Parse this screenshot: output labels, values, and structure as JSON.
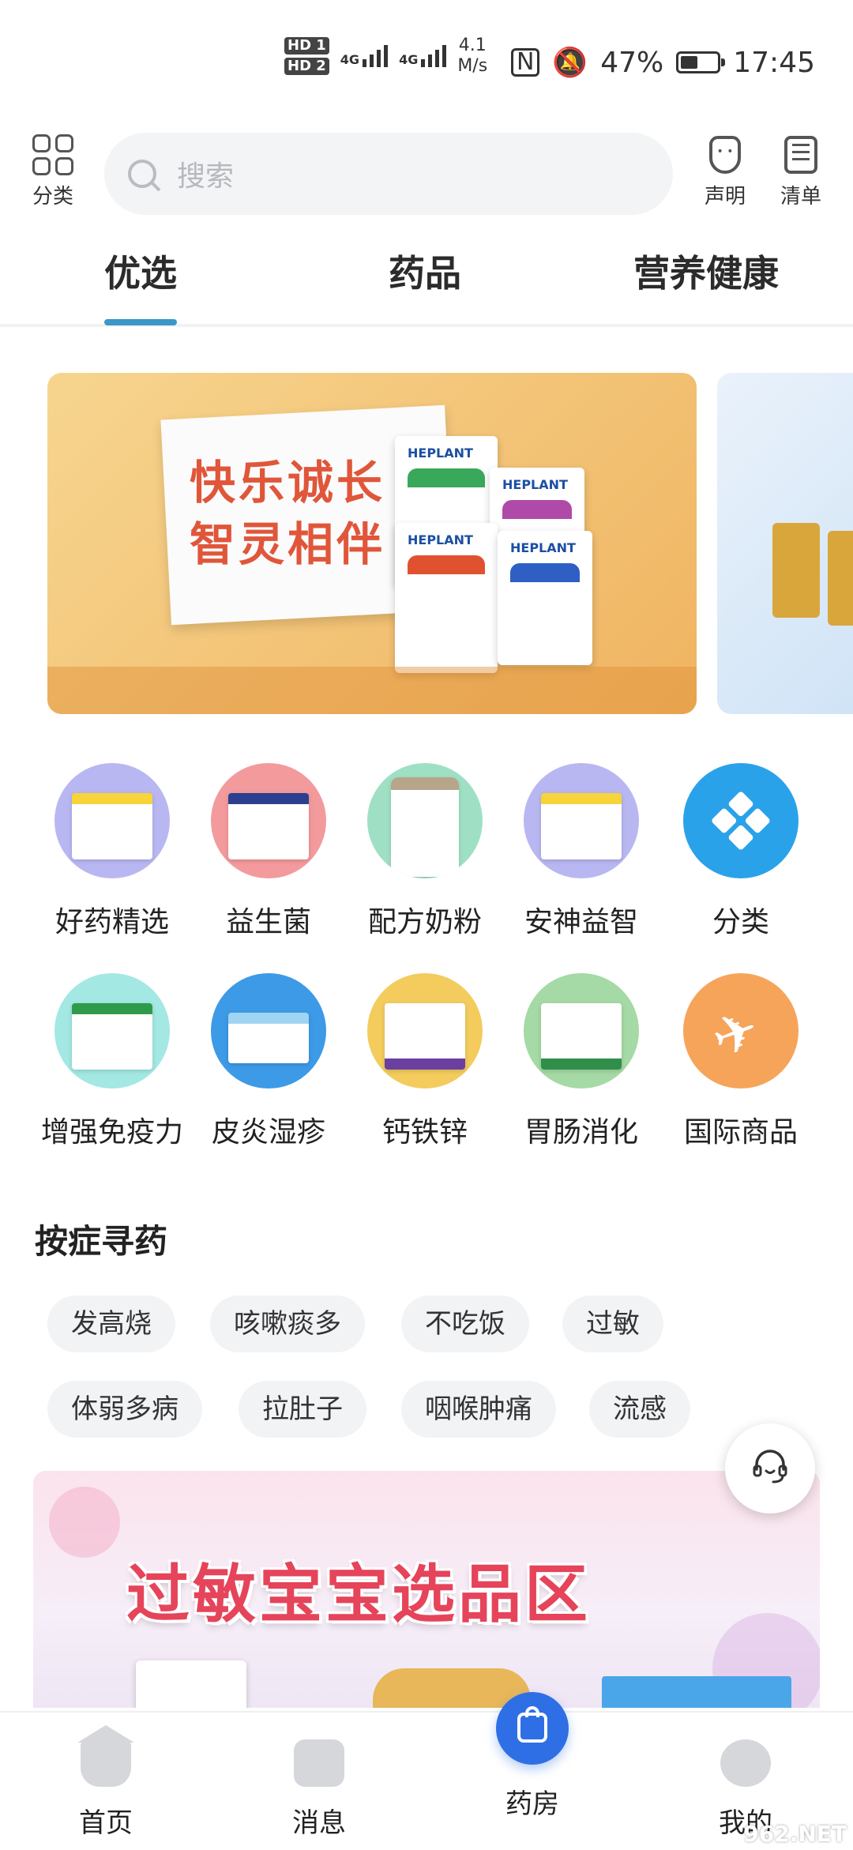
{
  "status_bar": {
    "hd1": "HD 1",
    "hd2": "HD 2",
    "net1": "4G",
    "net2": "4G",
    "speed": "4.1",
    "speed_unit": "M/s",
    "battery": "47%",
    "battery_level": 0.47,
    "time": "17:45"
  },
  "header": {
    "category_label": "分类",
    "search_placeholder": "搜索",
    "statement_label": "声明",
    "list_label": "清单"
  },
  "tabs": [
    {
      "label": "优选",
      "active": true
    },
    {
      "label": "药品",
      "active": false
    },
    {
      "label": "营养健康",
      "active": false
    }
  ],
  "banner": {
    "slogan_line1": "快乐诚长",
    "slogan_line2": "智灵相伴",
    "brand": "HEPLANT"
  },
  "categories": [
    {
      "label": "好药精选",
      "icon": "medicine-box-icon",
      "color": "#b9b7f2"
    },
    {
      "label": "益生菌",
      "icon": "probiotic-box-icon",
      "color": "#f39a9d"
    },
    {
      "label": "配方奶粉",
      "icon": "milk-powder-icon",
      "color": "#9fe0c4"
    },
    {
      "label": "安神益智",
      "icon": "medicine-box-icon",
      "color": "#b9b7f2"
    },
    {
      "label": "分类",
      "icon": "category-grid-icon",
      "color": "#2aa2ea"
    },
    {
      "label": "增强免疫力",
      "icon": "immunity-box-icon",
      "color": "#a3e8e2"
    },
    {
      "label": "皮炎湿疹",
      "icon": "ointment-icon",
      "color": "#3d9ae6"
    },
    {
      "label": "钙铁锌",
      "icon": "supplement-box-icon",
      "color": "#f3cc5d"
    },
    {
      "label": "胃肠消化",
      "icon": "granule-box-icon",
      "color": "#a5d9a5"
    },
    {
      "label": "国际商品",
      "icon": "airplane-icon",
      "color": "#f6a45a"
    }
  ],
  "symptoms": {
    "title": "按症寻药",
    "chips": [
      "发高烧",
      "咳嗽痰多",
      "不吃饭",
      "过敏",
      "体弱多病",
      "拉肚子",
      "咽喉肿痛",
      "流感"
    ]
  },
  "promo": {
    "title": "过敏宝宝选品区"
  },
  "bottom_nav": [
    {
      "label": "首页",
      "icon": "home-icon"
    },
    {
      "label": "消息",
      "icon": "message-icon"
    },
    {
      "label": "药房",
      "icon": "pharmacy-bag-icon",
      "active": true
    },
    {
      "label": "我的",
      "icon": "profile-icon"
    }
  ],
  "watermark": "962.NET"
}
